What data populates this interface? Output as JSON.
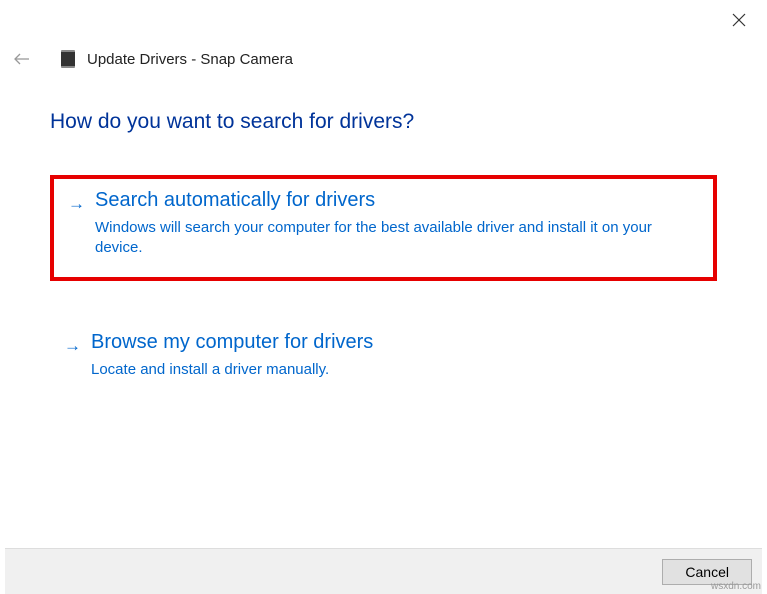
{
  "window": {
    "title": "Update Drivers - Snap Camera"
  },
  "heading": "How do you want to search for drivers?",
  "options": [
    {
      "title": "Search automatically for drivers",
      "description": "Windows will search your computer for the best available driver and install it on your device.",
      "highlighted": true
    },
    {
      "title": "Browse my computer for drivers",
      "description": "Locate and install a driver manually.",
      "highlighted": false
    }
  ],
  "footer": {
    "cancel_label": "Cancel"
  },
  "watermark": "wsxdn.com"
}
